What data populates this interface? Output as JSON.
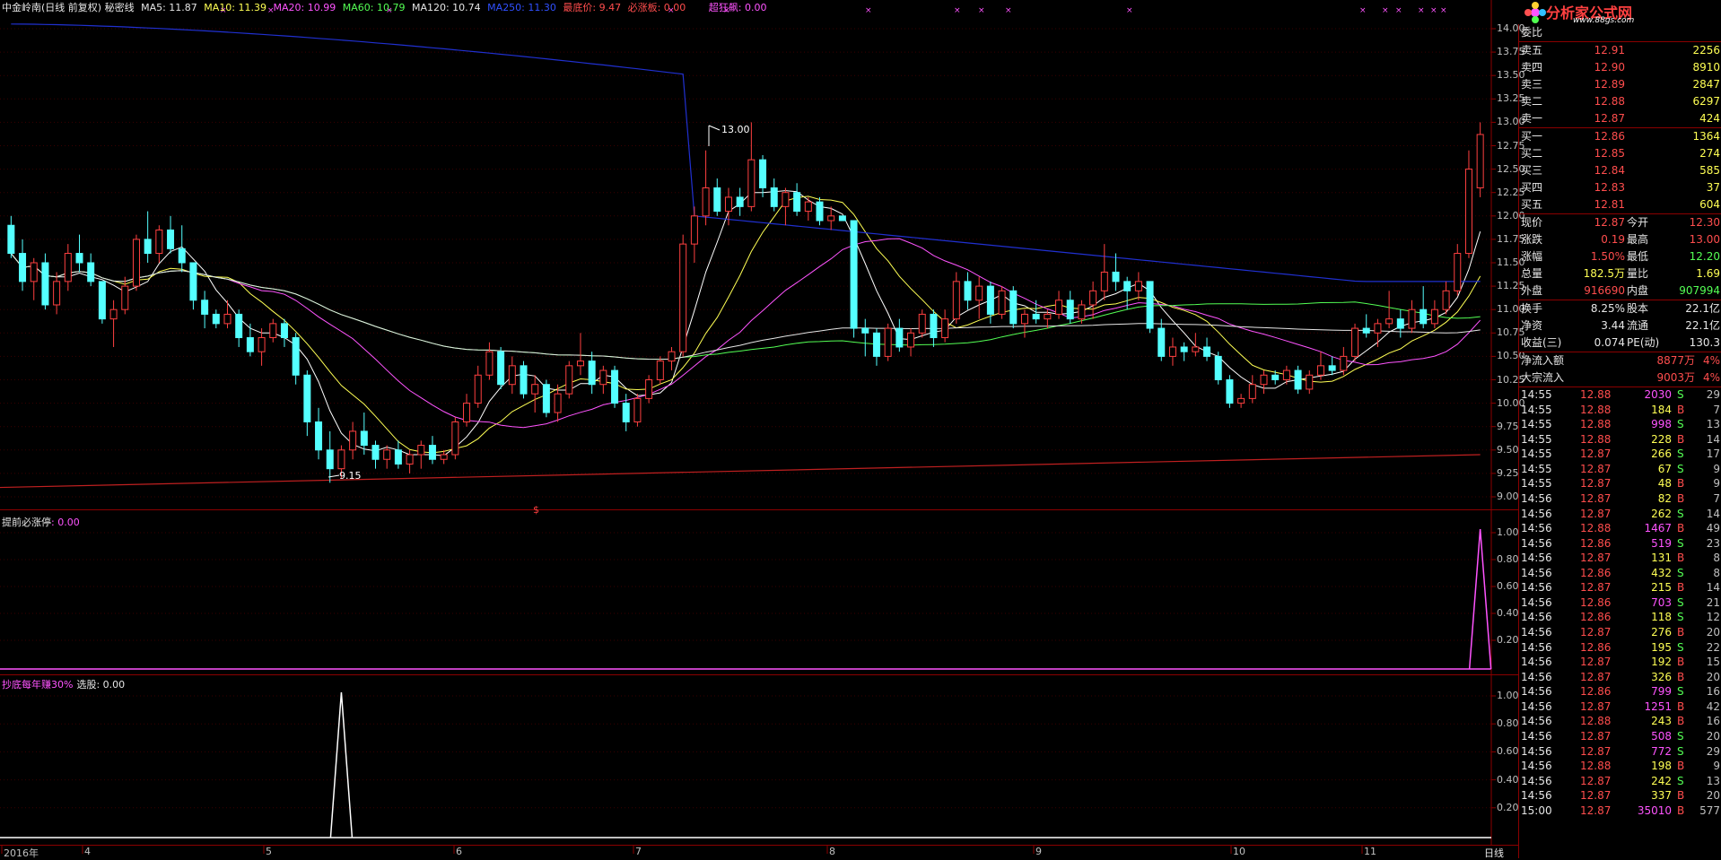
{
  "header": {
    "title": "中金岭南(日线 前复权) 秘密线",
    "ma5": "MA5: 11.87",
    "ma10": "MA10: 11.39",
    "ma20": "MA20: 10.99",
    "ma60": "MA60: 10.79",
    "ma120": "MA120: 10.74",
    "ma250": "MA250: 11.30",
    "lowest": "最底价: 9.47",
    "must_rise": "必涨板: 0.00",
    "super_rise": "超狂飙: 0.00"
  },
  "indicator1": {
    "label": "提前必涨停",
    "value": ": 0.00"
  },
  "indicator2": {
    "label": "抄底每年赚30%",
    "value": "选股: 0.00"
  },
  "annotations": {
    "high": "13.00",
    "low": "9.15",
    "marker": "$"
  },
  "main_y_ticks": [
    "14.00",
    "13.75",
    "13.50",
    "13.25",
    "13.00",
    "12.75",
    "12.50",
    "12.25",
    "12.00",
    "11.75",
    "11.50",
    "11.25",
    "11.00",
    "10.75",
    "10.50",
    "10.25",
    "10.00",
    "9.75",
    "9.50",
    "9.25",
    "9.00"
  ],
  "ind_y_ticks": [
    "1.00",
    "0.80",
    "0.60",
    "0.40",
    "0.20"
  ],
  "x_labels": [
    "2016年",
    "4",
    "5",
    "6",
    "7",
    "8",
    "9",
    "10",
    "11"
  ],
  "period_tab": "日线",
  "logo": {
    "text": "分析家公式网",
    "url": "www.88gs.com"
  },
  "quote": {
    "weibi_label": "委比",
    "asks": [
      {
        "label": "卖五",
        "price": "12.91",
        "vol": "2256"
      },
      {
        "label": "卖四",
        "price": "12.90",
        "vol": "8910"
      },
      {
        "label": "卖三",
        "price": "12.89",
        "vol": "2847"
      },
      {
        "label": "卖二",
        "price": "12.88",
        "vol": "6297"
      },
      {
        "label": "卖一",
        "price": "12.87",
        "vol": "424"
      }
    ],
    "bids": [
      {
        "label": "买一",
        "price": "12.86",
        "vol": "1364"
      },
      {
        "label": "买二",
        "price": "12.85",
        "vol": "274"
      },
      {
        "label": "买三",
        "price": "12.84",
        "vol": "585"
      },
      {
        "label": "买四",
        "price": "12.83",
        "vol": "37"
      },
      {
        "label": "买五",
        "price": "12.81",
        "vol": "604"
      }
    ],
    "stats": [
      {
        "l1": "现价",
        "v1": "12.87",
        "c1": "red",
        "l2": "今开",
        "v2": "12.30",
        "c2": "red"
      },
      {
        "l1": "涨跌",
        "v1": "0.19",
        "c1": "red",
        "l2": "最高",
        "v2": "13.00",
        "c2": "red"
      },
      {
        "l1": "涨幅",
        "v1": "1.50%",
        "c1": "red",
        "l2": "最低",
        "v2": "12.20",
        "c2": "grn"
      },
      {
        "l1": "总量",
        "v1": "182.5万",
        "c1": "yel",
        "l2": "量比",
        "v2": "1.69",
        "c2": "yel"
      },
      {
        "l1": "外盘",
        "v1": "916690",
        "c1": "red",
        "l2": "内盘",
        "v2": "907994",
        "c2": "grn"
      }
    ],
    "stats2": [
      {
        "l1": "换手",
        "v1": "8.25%",
        "c1": "wht",
        "l2": "股本",
        "v2": "22.1亿",
        "c2": "wht"
      },
      {
        "l1": "净资",
        "v1": "3.44",
        "c1": "wht",
        "l2": "流通",
        "v2": "22.1亿",
        "c2": "wht"
      },
      {
        "l1": "收益(三)",
        "v1": "0.074",
        "c1": "wht",
        "l2": "PE(动)",
        "v2": "130.3",
        "c2": "wht"
      }
    ],
    "flows": [
      {
        "label": "净流入额",
        "value": "8877万",
        "pct": "4%"
      },
      {
        "label": "大宗流入",
        "value": "9003万",
        "pct": "4%"
      }
    ]
  },
  "ticks": [
    {
      "t": "14:55",
      "p": "12.88",
      "v": "2030",
      "d": "S",
      "n": "29",
      "vc": "mag"
    },
    {
      "t": "14:55",
      "p": "12.88",
      "v": "184",
      "d": "B",
      "n": "7",
      "vc": "yel"
    },
    {
      "t": "14:55",
      "p": "12.88",
      "v": "998",
      "d": "S",
      "n": "13",
      "vc": "mag"
    },
    {
      "t": "14:55",
      "p": "12.88",
      "v": "228",
      "d": "B",
      "n": "14",
      "vc": "yel"
    },
    {
      "t": "14:55",
      "p": "12.87",
      "v": "266",
      "d": "S",
      "n": "17",
      "vc": "yel"
    },
    {
      "t": "14:55",
      "p": "12.87",
      "v": "67",
      "d": "S",
      "n": "9",
      "vc": "yel"
    },
    {
      "t": "14:55",
      "p": "12.87",
      "v": "48",
      "d": "B",
      "n": "9",
      "vc": "yel"
    },
    {
      "t": "14:56",
      "p": "12.87",
      "v": "82",
      "d": "B",
      "n": "7",
      "vc": "yel"
    },
    {
      "t": "14:56",
      "p": "12.87",
      "v": "262",
      "d": "S",
      "n": "14",
      "vc": "yel"
    },
    {
      "t": "14:56",
      "p": "12.88",
      "v": "1467",
      "d": "B",
      "n": "49",
      "vc": "mag"
    },
    {
      "t": "14:56",
      "p": "12.86",
      "v": "519",
      "d": "S",
      "n": "23",
      "vc": "mag"
    },
    {
      "t": "14:56",
      "p": "12.87",
      "v": "131",
      "d": "B",
      "n": "8",
      "vc": "yel"
    },
    {
      "t": "14:56",
      "p": "12.86",
      "v": "432",
      "d": "S",
      "n": "8",
      "vc": "yel"
    },
    {
      "t": "14:56",
      "p": "12.87",
      "v": "215",
      "d": "B",
      "n": "14",
      "vc": "yel"
    },
    {
      "t": "14:56",
      "p": "12.86",
      "v": "703",
      "d": "S",
      "n": "21",
      "vc": "mag"
    },
    {
      "t": "14:56",
      "p": "12.86",
      "v": "118",
      "d": "S",
      "n": "12",
      "vc": "yel"
    },
    {
      "t": "14:56",
      "p": "12.87",
      "v": "276",
      "d": "B",
      "n": "20",
      "vc": "yel"
    },
    {
      "t": "14:56",
      "p": "12.86",
      "v": "195",
      "d": "S",
      "n": "22",
      "vc": "yel"
    },
    {
      "t": "14:56",
      "p": "12.87",
      "v": "192",
      "d": "B",
      "n": "15",
      "vc": "yel"
    },
    {
      "t": "14:56",
      "p": "12.87",
      "v": "326",
      "d": "B",
      "n": "20",
      "vc": "yel"
    },
    {
      "t": "14:56",
      "p": "12.86",
      "v": "799",
      "d": "S",
      "n": "16",
      "vc": "mag"
    },
    {
      "t": "14:56",
      "p": "12.87",
      "v": "1251",
      "d": "B",
      "n": "42",
      "vc": "mag"
    },
    {
      "t": "14:56",
      "p": "12.88",
      "v": "243",
      "d": "B",
      "n": "16",
      "vc": "yel"
    },
    {
      "t": "14:56",
      "p": "12.87",
      "v": "508",
      "d": "S",
      "n": "20",
      "vc": "mag"
    },
    {
      "t": "14:56",
      "p": "12.87",
      "v": "772",
      "d": "S",
      "n": "29",
      "vc": "mag"
    },
    {
      "t": "14:56",
      "p": "12.88",
      "v": "198",
      "d": "B",
      "n": "9",
      "vc": "yel"
    },
    {
      "t": "14:56",
      "p": "12.87",
      "v": "242",
      "d": "S",
      "n": "13",
      "vc": "yel"
    },
    {
      "t": "14:56",
      "p": "12.87",
      "v": "337",
      "d": "B",
      "n": "20",
      "vc": "yel"
    },
    {
      "t": "15:00",
      "p": "12.87",
      "v": "35010",
      "d": "B",
      "n": "577",
      "vc": "mag"
    }
  ],
  "chart_data": {
    "type": "candlestick",
    "ylim": [
      9.0,
      14.0
    ],
    "candles": [
      [
        11.9,
        12.0,
        11.55,
        11.6
      ],
      [
        11.6,
        11.75,
        11.2,
        11.3
      ],
      [
        11.3,
        11.55,
        11.1,
        11.5
      ],
      [
        11.5,
        11.6,
        11.0,
        11.05
      ],
      [
        11.05,
        11.4,
        10.95,
        11.3
      ],
      [
        11.3,
        11.7,
        11.2,
        11.6
      ],
      [
        11.6,
        11.8,
        11.4,
        11.5
      ],
      [
        11.5,
        11.6,
        11.25,
        11.3
      ],
      [
        11.3,
        11.3,
        10.85,
        10.9
      ],
      [
        10.9,
        11.1,
        10.6,
        11.0
      ],
      [
        11.0,
        11.35,
        10.95,
        11.25
      ],
      [
        11.25,
        11.8,
        11.2,
        11.75
      ],
      [
        11.75,
        12.05,
        11.5,
        11.6
      ],
      [
        11.6,
        11.9,
        11.5,
        11.85
      ],
      [
        11.85,
        12.0,
        11.6,
        11.65
      ],
      [
        11.65,
        11.9,
        11.4,
        11.5
      ],
      [
        11.5,
        11.5,
        11.0,
        11.1
      ],
      [
        11.1,
        11.2,
        10.8,
        10.95
      ],
      [
        10.95,
        11.0,
        10.8,
        10.85
      ],
      [
        10.85,
        11.1,
        10.8,
        10.95
      ],
      [
        10.95,
        11.0,
        10.6,
        10.7
      ],
      [
        10.7,
        10.85,
        10.5,
        10.55
      ],
      [
        10.55,
        10.8,
        10.4,
        10.7
      ],
      [
        10.7,
        10.9,
        10.65,
        10.85
      ],
      [
        10.85,
        10.9,
        10.6,
        10.7
      ],
      [
        10.7,
        10.75,
        10.2,
        10.3
      ],
      [
        10.3,
        10.35,
        9.65,
        9.8
      ],
      [
        9.8,
        9.95,
        9.4,
        9.5
      ],
      [
        9.5,
        9.7,
        9.15,
        9.3
      ],
      [
        9.3,
        9.55,
        9.2,
        9.5
      ],
      [
        9.5,
        9.8,
        9.4,
        9.7
      ],
      [
        9.7,
        9.9,
        9.45,
        9.55
      ],
      [
        9.55,
        9.6,
        9.3,
        9.4
      ],
      [
        9.4,
        9.55,
        9.3,
        9.5
      ],
      [
        9.5,
        9.6,
        9.3,
        9.35
      ],
      [
        9.35,
        9.5,
        9.25,
        9.45
      ],
      [
        9.45,
        9.6,
        9.3,
        9.55
      ],
      [
        9.55,
        9.65,
        9.35,
        9.4
      ],
      [
        9.4,
        9.5,
        9.35,
        9.45
      ],
      [
        9.45,
        9.85,
        9.4,
        9.8
      ],
      [
        9.8,
        10.1,
        9.75,
        10.0
      ],
      [
        10.0,
        10.4,
        9.95,
        10.3
      ],
      [
        10.3,
        10.65,
        10.25,
        10.55
      ],
      [
        10.55,
        10.6,
        10.15,
        10.2
      ],
      [
        10.2,
        10.5,
        10.1,
        10.4
      ],
      [
        10.4,
        10.45,
        10.05,
        10.1
      ],
      [
        10.1,
        10.3,
        9.9,
        10.2
      ],
      [
        10.2,
        10.25,
        9.85,
        9.9
      ],
      [
        9.9,
        10.2,
        9.8,
        10.1
      ],
      [
        10.1,
        10.45,
        10.05,
        10.4
      ],
      [
        10.4,
        10.75,
        10.3,
        10.45
      ],
      [
        10.45,
        10.55,
        10.1,
        10.2
      ],
      [
        10.2,
        10.4,
        10.1,
        10.35
      ],
      [
        10.35,
        10.4,
        9.95,
        10.0
      ],
      [
        10.0,
        10.1,
        9.7,
        9.8
      ],
      [
        9.8,
        10.1,
        9.75,
        10.05
      ],
      [
        10.05,
        10.3,
        10.0,
        10.25
      ],
      [
        10.25,
        10.5,
        10.2,
        10.45
      ],
      [
        10.45,
        10.6,
        10.35,
        10.55
      ],
      [
        10.55,
        11.8,
        10.5,
        11.7
      ],
      [
        11.7,
        12.1,
        11.5,
        12.0
      ],
      [
        12.0,
        12.7,
        11.9,
        12.3
      ],
      [
        12.3,
        12.4,
        12.0,
        12.05
      ],
      [
        12.05,
        12.3,
        11.9,
        12.2
      ],
      [
        12.2,
        12.3,
        12.0,
        12.1
      ],
      [
        12.1,
        13.0,
        12.05,
        12.6
      ],
      [
        12.6,
        12.65,
        12.2,
        12.3
      ],
      [
        12.3,
        12.4,
        12.05,
        12.1
      ],
      [
        12.1,
        12.3,
        11.9,
        12.25
      ],
      [
        12.25,
        12.35,
        12.0,
        12.05
      ],
      [
        12.05,
        12.2,
        11.95,
        12.15
      ],
      [
        12.15,
        12.2,
        11.9,
        11.95
      ],
      [
        11.95,
        12.1,
        11.85,
        12.0
      ],
      [
        12.0,
        12.0,
        11.95,
        11.95
      ],
      [
        11.95,
        11.95,
        10.7,
        10.8
      ],
      [
        10.8,
        10.9,
        10.5,
        10.75
      ],
      [
        10.75,
        10.8,
        10.4,
        10.5
      ],
      [
        10.5,
        10.85,
        10.45,
        10.8
      ],
      [
        10.8,
        10.9,
        10.55,
        10.6
      ],
      [
        10.6,
        10.8,
        10.5,
        10.75
      ],
      [
        10.75,
        11.0,
        10.7,
        10.95
      ],
      [
        10.95,
        11.0,
        10.6,
        10.7
      ],
      [
        10.7,
        11.0,
        10.65,
        10.9
      ],
      [
        10.9,
        11.4,
        10.85,
        11.3
      ],
      [
        11.3,
        11.4,
        11.0,
        11.1
      ],
      [
        11.1,
        11.35,
        10.9,
        11.25
      ],
      [
        11.25,
        11.3,
        10.85,
        10.95
      ],
      [
        10.95,
        11.25,
        10.9,
        11.2
      ],
      [
        11.2,
        11.25,
        10.8,
        10.85
      ],
      [
        10.85,
        11.0,
        10.7,
        10.95
      ],
      [
        10.95,
        11.1,
        10.85,
        10.9
      ],
      [
        10.9,
        11.0,
        10.8,
        10.95
      ],
      [
        10.95,
        11.2,
        10.9,
        11.1
      ],
      [
        11.1,
        11.2,
        10.85,
        10.9
      ],
      [
        10.9,
        11.1,
        10.85,
        11.05
      ],
      [
        11.05,
        11.3,
        10.9,
        11.2
      ],
      [
        11.2,
        11.7,
        11.1,
        11.4
      ],
      [
        11.4,
        11.6,
        11.2,
        11.3
      ],
      [
        11.3,
        11.35,
        11.0,
        11.2
      ],
      [
        11.2,
        11.4,
        11.1,
        11.3
      ],
      [
        11.3,
        11.3,
        10.75,
        10.8
      ],
      [
        10.8,
        10.9,
        10.45,
        10.5
      ],
      [
        10.5,
        10.7,
        10.4,
        10.6
      ],
      [
        10.6,
        10.65,
        10.45,
        10.55
      ],
      [
        10.55,
        10.75,
        10.5,
        10.6
      ],
      [
        10.6,
        10.7,
        10.45,
        10.5
      ],
      [
        10.5,
        10.55,
        10.2,
        10.25
      ],
      [
        10.25,
        10.3,
        9.95,
        10.0
      ],
      [
        10.0,
        10.1,
        9.95,
        10.05
      ],
      [
        10.05,
        10.3,
        10.0,
        10.2
      ],
      [
        10.2,
        10.35,
        10.1,
        10.3
      ],
      [
        10.3,
        10.35,
        10.2,
        10.25
      ],
      [
        10.25,
        10.4,
        10.2,
        10.35
      ],
      [
        10.35,
        10.4,
        10.1,
        10.15
      ],
      [
        10.15,
        10.35,
        10.1,
        10.3
      ],
      [
        10.3,
        10.55,
        10.25,
        10.4
      ],
      [
        10.4,
        10.5,
        10.3,
        10.35
      ],
      [
        10.35,
        10.6,
        10.3,
        10.5
      ],
      [
        10.5,
        10.85,
        10.45,
        10.8
      ],
      [
        10.8,
        10.95,
        10.7,
        10.75
      ],
      [
        10.75,
        10.9,
        10.6,
        10.85
      ],
      [
        10.85,
        11.2,
        10.8,
        10.9
      ],
      [
        10.9,
        11.0,
        10.7,
        10.8
      ],
      [
        10.8,
        11.1,
        10.75,
        11.0
      ],
      [
        11.0,
        11.25,
        10.8,
        10.85
      ],
      [
        10.85,
        11.1,
        10.8,
        11.0
      ],
      [
        11.0,
        11.3,
        10.95,
        11.2
      ],
      [
        11.2,
        11.7,
        11.15,
        11.6
      ],
      [
        11.6,
        12.7,
        11.55,
        12.5
      ],
      [
        12.3,
        13.0,
        12.2,
        12.87
      ]
    ],
    "indicator1_spike_index": 129,
    "indicator2_spike_index": 29
  }
}
